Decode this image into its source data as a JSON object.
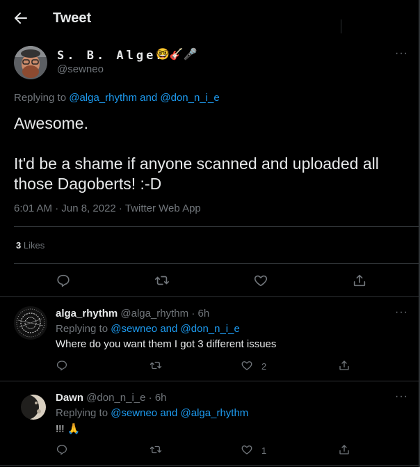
{
  "header": {
    "title": "Tweet"
  },
  "main_tweet": {
    "author_name": "S. B. Alger",
    "author_emojis": "🤓🎸🎤",
    "author_handle": "@sewneo",
    "replying_prefix": "Replying to",
    "replying_user1": "@alga_rhythm",
    "replying_and": "and",
    "replying_user2": "@don_n_i_e",
    "text_line1": "Awesome.",
    "text_line2": "It'd be a shame if anyone scanned and uploaded all those Dagoberts! :-D",
    "timestamp": "6:01 AM · Jun 8, 2022 · Twitter Web App",
    "likes_count": "3",
    "likes_label": "Likes",
    "more_label": "···"
  },
  "replies": [
    {
      "name": "alga_rhythm",
      "meta": "@alga_rhythm · 6h",
      "replying_prefix": "Replying to",
      "replying_user1": "@sewneo",
      "replying_and": "and",
      "replying_user2": "@don_n_i_e",
      "text": "Where do you want them I got 3 different issues",
      "like_count": "2",
      "more_label": "···"
    },
    {
      "name": "Dawn",
      "meta": "@don_n_i_e · 6h",
      "replying_prefix": "Replying to",
      "replying_user1": "@sewneo",
      "replying_and": "and",
      "replying_user2": "@alga_rhythm",
      "text": "!!! 🙏",
      "like_count": "1",
      "more_label": "···"
    }
  ],
  "colors": {
    "accent": "#1d9bf0",
    "background": "#000000",
    "muted": "#71767b",
    "border": "#2f3336"
  },
  "icons": [
    "back-arrow-icon",
    "more-icon",
    "reply-icon",
    "retweet-icon",
    "like-icon",
    "share-icon"
  ]
}
